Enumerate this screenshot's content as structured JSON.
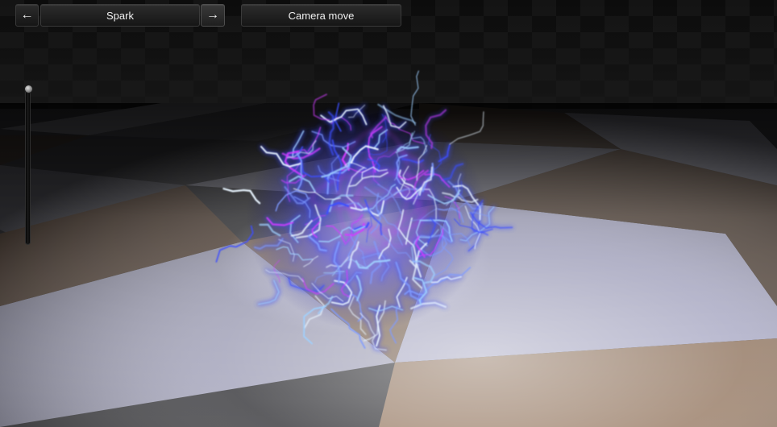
{
  "toolbar": {
    "prev_label": "←",
    "effect_name": "Spark",
    "next_label": "→",
    "camera_label": "Camera move"
  },
  "slider": {
    "value": 1.0
  },
  "colors": {
    "spark_core": "#e8f4ff",
    "spark_blue": "#3b4dff",
    "spark_magenta": "#d03cff",
    "floor_light": "#c9c9e6",
    "floor_tan": "#8c6c52"
  }
}
